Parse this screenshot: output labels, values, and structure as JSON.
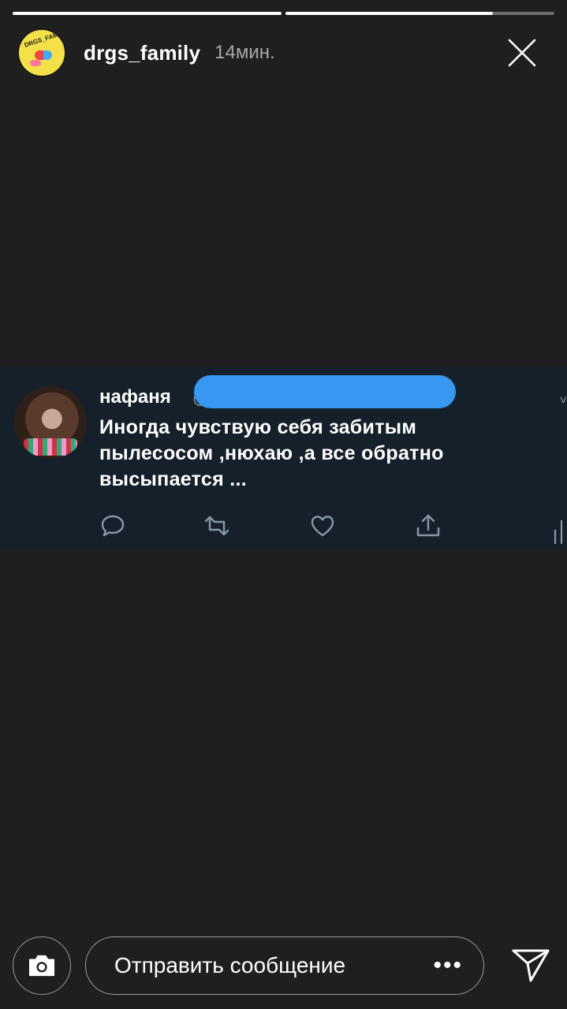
{
  "story": {
    "progress": [
      1.0,
      0.77
    ],
    "username": "drgs_family",
    "time": "14мин.",
    "avatar_lettering": "DRGS_FAMILY",
    "icons": {
      "close": "close-icon",
      "camera": "camera-icon",
      "more": "more-dots-icon",
      "send": "send-icon"
    }
  },
  "tweet": {
    "name": "нафаня",
    "handle": "@",
    "text": "Иногда чувствую себя забитым пылесосом ,нюхаю ,а все обратно высыпается ...",
    "redaction_color": "#3897f0",
    "background_color": "#15202b",
    "actions": [
      "reply-icon",
      "retweet-icon",
      "like-icon",
      "share-icon"
    ]
  },
  "composer": {
    "placeholder": "Отправить сообщение",
    "more_label": "•••"
  }
}
